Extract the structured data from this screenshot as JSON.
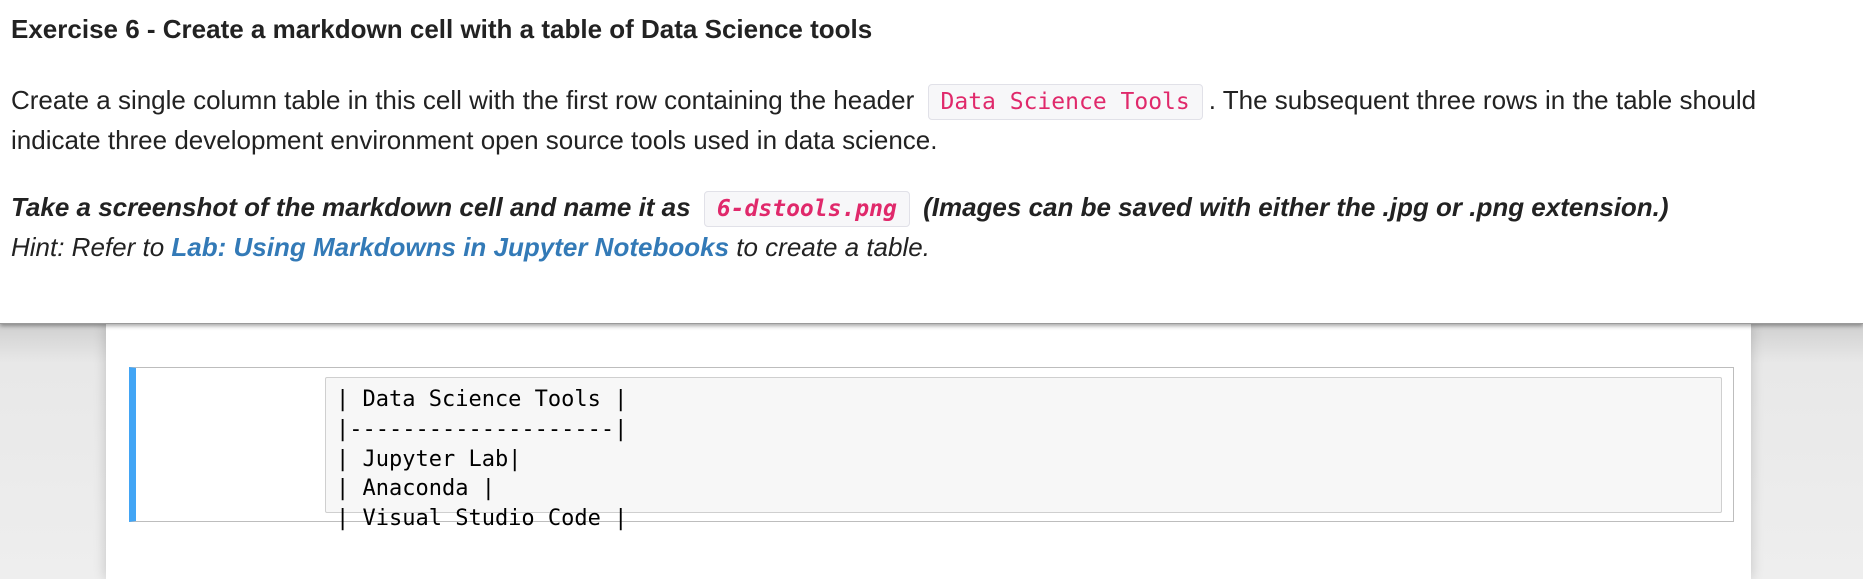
{
  "exercise": {
    "title": "Exercise 6 - Create a markdown cell with a table of Data Science tools",
    "para1_before": "Create a single column table in this cell with the first row containing the header",
    "para1_code": "Data Science Tools",
    "para1_after": ". The subsequent three rows in the table should",
    "para2": "indicate three development environment open source tools used in data science.",
    "screenshot_before": "Take a screenshot of the markdown cell and name it as",
    "screenshot_code": "6-dstools.png",
    "screenshot_after": "(Images can be saved with either the .jpg or .png extension.)",
    "hint_before": "Hint: Refer to ",
    "hint_link": "Lab: Using Markdowns in Jupyter Notebooks",
    "hint_after": " to create a table."
  },
  "cell": {
    "lines": [
      "| Data Science Tools |",
      "|--------------------|",
      "| Jupyter Lab|",
      "| Anaconda |",
      "| Visual Studio Code |"
    ]
  },
  "colors": {
    "accent": "#42a5f5",
    "link": "#337ab7",
    "code_text": "#e0296b"
  }
}
